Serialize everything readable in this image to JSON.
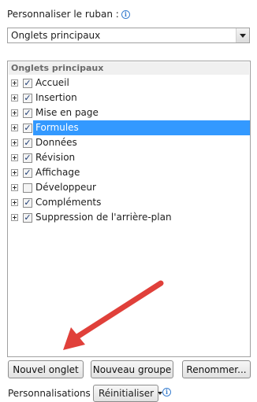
{
  "customize": {
    "label": "Personnaliser le ruban :",
    "dropdown_value": "Onglets principaux"
  },
  "tree": {
    "header": "Onglets principaux",
    "items": [
      {
        "label": "Accueil",
        "checked": true
      },
      {
        "label": "Insertion",
        "checked": true
      },
      {
        "label": "Mise en page",
        "checked": true
      },
      {
        "label": "Formules",
        "checked": true,
        "selected": true
      },
      {
        "label": "Données",
        "checked": true
      },
      {
        "label": "Révision",
        "checked": true
      },
      {
        "label": "Affichage",
        "checked": true
      },
      {
        "label": "Développeur",
        "checked": false
      },
      {
        "label": "Compléments",
        "checked": true
      },
      {
        "label": "Suppression de l'arrière-plan",
        "checked": true
      }
    ]
  },
  "buttons": {
    "new_tab": "Nouvel onglet",
    "new_group": "Nouveau groupe",
    "rename": "Renommer..."
  },
  "footer": {
    "label": "Personnalisations :",
    "reset": "Réinitialiser"
  },
  "colors": {
    "selection": "#3399ff",
    "annotation_arrow": "#e0403a"
  },
  "icons": [
    "info-icon",
    "dropdown-arrow-icon",
    "expand-icon",
    "checkbox-icon"
  ]
}
